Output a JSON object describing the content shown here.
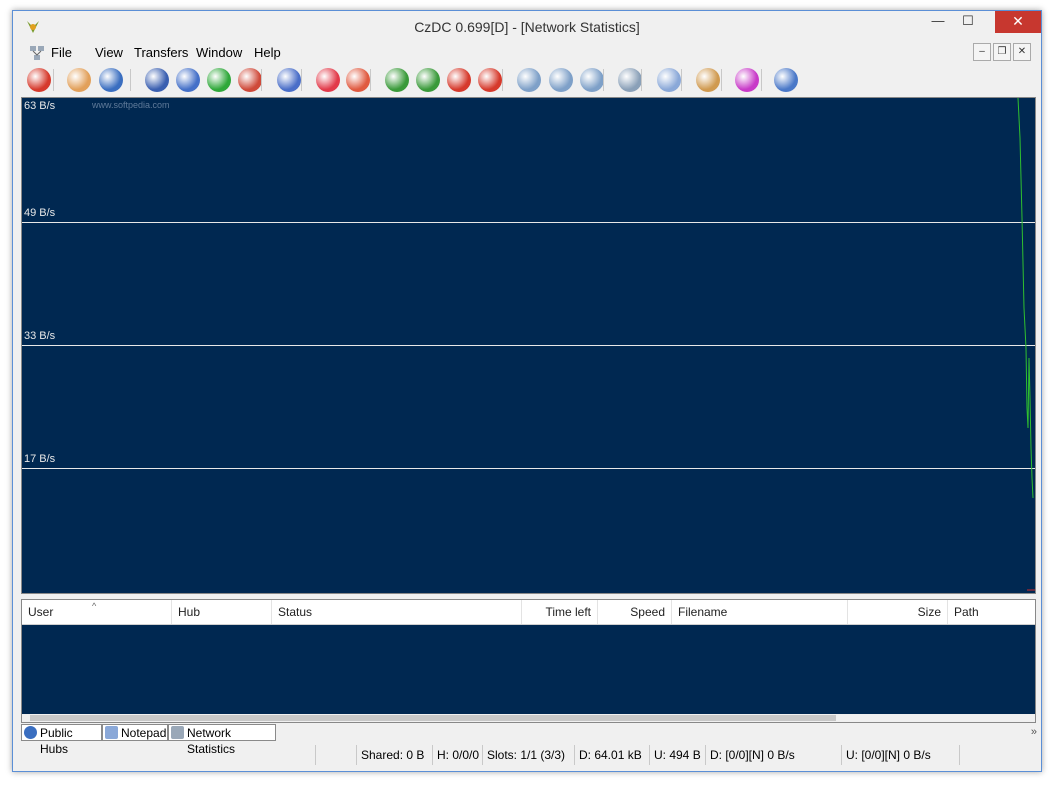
{
  "window": {
    "title": "CzDC 0.699[D] - [Network Statistics]",
    "min_glyph": "—",
    "max_glyph": "☐",
    "close_glyph": "✕"
  },
  "menu": {
    "items": [
      "File",
      "View",
      "Transfers",
      "Window",
      "Help"
    ],
    "mdi_min": "–",
    "mdi_restore": "❐",
    "mdi_close": "✕"
  },
  "toolbar": {
    "buttons": [
      {
        "name": "disconnect-icon",
        "color": "#d63a2c"
      },
      {
        "name": "open-folder-icon",
        "color": "#e2a05a"
      },
      {
        "name": "public-hubs-icon",
        "color": "#3a6ec0"
      },
      {
        "name": "reconnect-icon",
        "color": "#3a5fb0"
      },
      {
        "name": "follow-redirect-icon",
        "color": "#4470c8"
      },
      {
        "name": "favorite-hubs-icon",
        "color": "#2fa83a"
      },
      {
        "name": "favorite-users-icon",
        "color": "#cf4a3a"
      },
      {
        "name": "check-icon",
        "color": "#4a6ec8"
      },
      {
        "name": "heart-icon",
        "color": "#e23a4a"
      },
      {
        "name": "user-icon",
        "color": "#e05a40"
      },
      {
        "name": "download-queue-icon",
        "color": "#3a9a3a"
      },
      {
        "name": "finished-downloads-icon",
        "color": "#3a9a3a"
      },
      {
        "name": "upload-queue-icon",
        "color": "#d63a2c"
      },
      {
        "name": "finished-uploads-icon",
        "color": "#d63a2c"
      },
      {
        "name": "search-icon",
        "color": "#7ea0c8"
      },
      {
        "name": "adl-search-icon",
        "color": "#7ea0c8"
      },
      {
        "name": "search-spy-icon",
        "color": "#7ea0c8"
      },
      {
        "name": "network-stats-icon",
        "color": "#8aa0b8"
      },
      {
        "name": "notepad-icon",
        "color": "#8aa8d8"
      },
      {
        "name": "file-list-icon",
        "color": "#d09a50"
      },
      {
        "name": "settings-icon",
        "color": "#c83ac8"
      },
      {
        "name": "edit-icon",
        "color": "#4a78c8"
      }
    ]
  },
  "graph": {
    "watermark": "www.softpedia.com",
    "labels": [
      "63 B/s",
      "49 B/s",
      "33 B/s",
      "17 B/s"
    ],
    "line_color": "#2fbf2f"
  },
  "transfers": {
    "columns": [
      "User",
      "Hub",
      "Status",
      "Time left",
      "Speed",
      "Filename",
      "Size",
      "Path"
    ],
    "sort_glyph": "^"
  },
  "tabs": [
    {
      "label": "Public Hubs",
      "icon": "globe-icon"
    },
    {
      "label": "Notepad",
      "icon": "notepad-icon"
    },
    {
      "label": "Network Statistics",
      "icon": "network-icon"
    }
  ],
  "tabs_more": "»",
  "status": {
    "shared": "Shared: 0 B",
    "hubs": "H: 0/0/0",
    "slots": "Slots: 1/1 (3/3)",
    "downloaded": "D: 64.01 kB",
    "uploaded": "U: 494 B",
    "down_rate": "D: [0/0][N] 0 B/s",
    "up_rate": "U: [0/0][N] 0 B/s"
  }
}
